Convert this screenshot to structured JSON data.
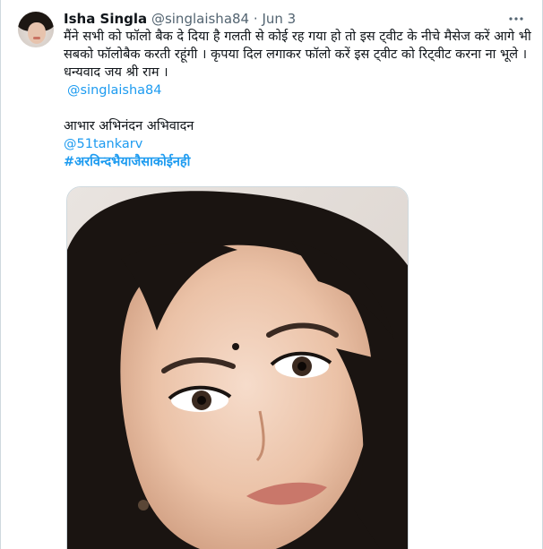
{
  "tweet": {
    "author_name": "Isha Singla",
    "author_handle": "@singlaisha84",
    "separator": "·",
    "date": "Jun 3",
    "more_icon": "more-horizontal-icon",
    "text_lines": [
      "मैंने सभी को फॉलो बैक दे दिया है गलती से कोई रह गया हो तो इस ट्वीट के नीचे मैसेज करें आगे भी",
      "सबको  फॉलोबैक करती रहूंगी । कृपया दिल लगाकर फॉलो करें इस ट्वीट को रिट्वीट करना ना भूले ।",
      "धन्यवाद जय श्री राम ।"
    ],
    "mention_1": "@singlaisha84",
    "thanks_line": "आभार अभिनंदन अभिवादन",
    "mention_2": "@51tankarv",
    "hashtag": "#अरविन्दभैयाजैसाकोईनही"
  },
  "colors": {
    "text": "#0f1419",
    "secondary": "#536471",
    "link": "#1d9bf0",
    "border": "#cfd9de"
  }
}
